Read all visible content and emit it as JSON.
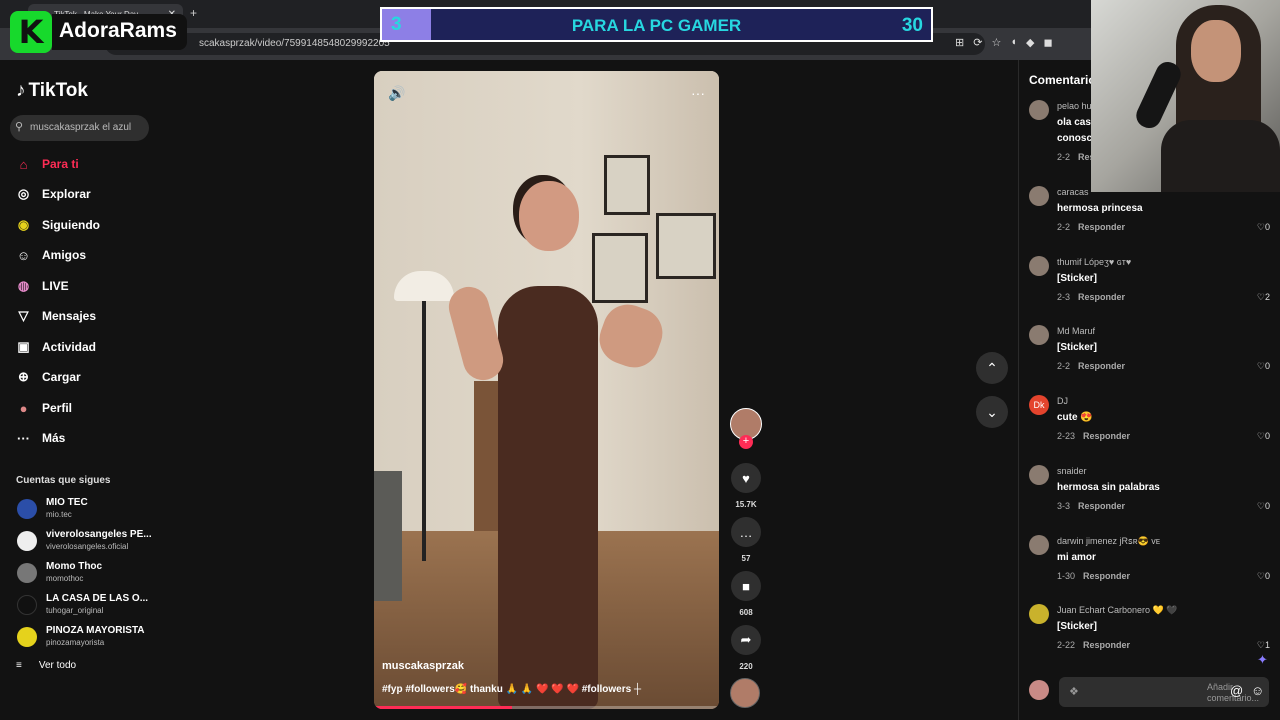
{
  "browser": {
    "tab_title": "TikTok - Make Your Day",
    "close": "✕",
    "new_tab": "+",
    "url": "scakasprzak/video/7599148548029992205",
    "toolbar_icons": [
      "⊞",
      "⟳",
      "☆",
      "◖",
      "◆",
      "◼"
    ]
  },
  "stream_overlay": {
    "logo_letter": "K",
    "logo_name": "AdoraRams",
    "goal_current": "3",
    "goal_text": "PARA LA PC GAMER",
    "goal_target": "30"
  },
  "sidebar": {
    "brand": "TikTok",
    "search_value": "muscakasprzak el azul",
    "nav": [
      {
        "label": "Para ti",
        "icon": "⌂",
        "active": true
      },
      {
        "label": "Explorar",
        "icon": "◎"
      },
      {
        "label": "Siguiendo",
        "icon": "◉"
      },
      {
        "label": "Amigos",
        "icon": "☺"
      },
      {
        "label": "LIVE",
        "icon": "◍"
      },
      {
        "label": "Mensajes",
        "icon": "▽"
      },
      {
        "label": "Actividad",
        "icon": "▣"
      },
      {
        "label": "Cargar",
        "icon": "⊕"
      },
      {
        "label": "Perfil",
        "icon": "●"
      },
      {
        "label": "Más",
        "icon": "···"
      }
    ],
    "following_title": "Cuentas que sigues",
    "accounts": [
      {
        "name": "MIO TEC",
        "handle": "mio.tec"
      },
      {
        "name": "viverolosangeles PE...",
        "handle": "viverolosangeles.oficial"
      },
      {
        "name": "Momo Thoc",
        "handle": "momothoc"
      },
      {
        "name": "LA CASA DE LAS O...",
        "handle": "tuhogar_original"
      },
      {
        "name": "PINOZA MAYORISTA",
        "handle": "pinozamayorista"
      }
    ],
    "see_all": "Ver todo",
    "see_all_icon": "≡"
  },
  "video": {
    "volume_icon": "🔊",
    "more_icon": "···",
    "author": "muscakasprzak",
    "caption": "#fyp  #followers🥰 thanku 🙏 🙏 ❤️ ❤️ ❤️   #followers ┼",
    "progress": 0.4
  },
  "actions": {
    "follow": "+",
    "like_icon": "♥",
    "likes": "15.7K",
    "comment_icon": "…",
    "comments": "57",
    "save_icon": "■",
    "saves": "608",
    "share_icon": "➦",
    "shares": "220"
  },
  "feed_nav": {
    "up": "⌃",
    "down": "⌄"
  },
  "comments_panel": {
    "title": "Comentarios",
    "items": [
      {
        "user": "pelao hu...",
        "text": "ola casa...",
        "text2": "conosca...",
        "date": "2-2",
        "reply": "Responder",
        "likes": ""
      },
      {
        "user": "caracas",
        "text": "hermosa princesa",
        "date": "2-2",
        "reply": "Responder",
        "likes": "♡0"
      },
      {
        "user": "thumif Lópeʒ♥ ɢᴛ♥",
        "text": "[Sticker]",
        "date": "2-3",
        "reply": "Responder",
        "likes": "♡2"
      },
      {
        "user": "Md Maruf",
        "text": "[Sticker]",
        "date": "2-2",
        "reply": "Responder",
        "likes": "♡0"
      },
      {
        "user": "DJ",
        "avatar": "Dk",
        "text": "cute 😍",
        "date": "2-23",
        "reply": "Responder",
        "likes": "♡0"
      },
      {
        "user": "snaider",
        "text": "hermosa sin palabras",
        "date": "3-3",
        "reply": "Responder",
        "likes": "♡0"
      },
      {
        "user": "darwin jimenez jRꜱʀ😎 ᴠᴇ",
        "text": "mi amor",
        "date": "1-30",
        "reply": "Responder",
        "likes": "♡0"
      },
      {
        "user": "Juan Echart Carbonero 💛 🖤",
        "text": "[Sticker]",
        "date": "2-22",
        "reply": "Responder",
        "likes": "♡1"
      }
    ],
    "input_placeholder": "Añadir comentario...",
    "sticker_icon": "❖",
    "at_icon": "@",
    "emoji_icon": "☺"
  }
}
